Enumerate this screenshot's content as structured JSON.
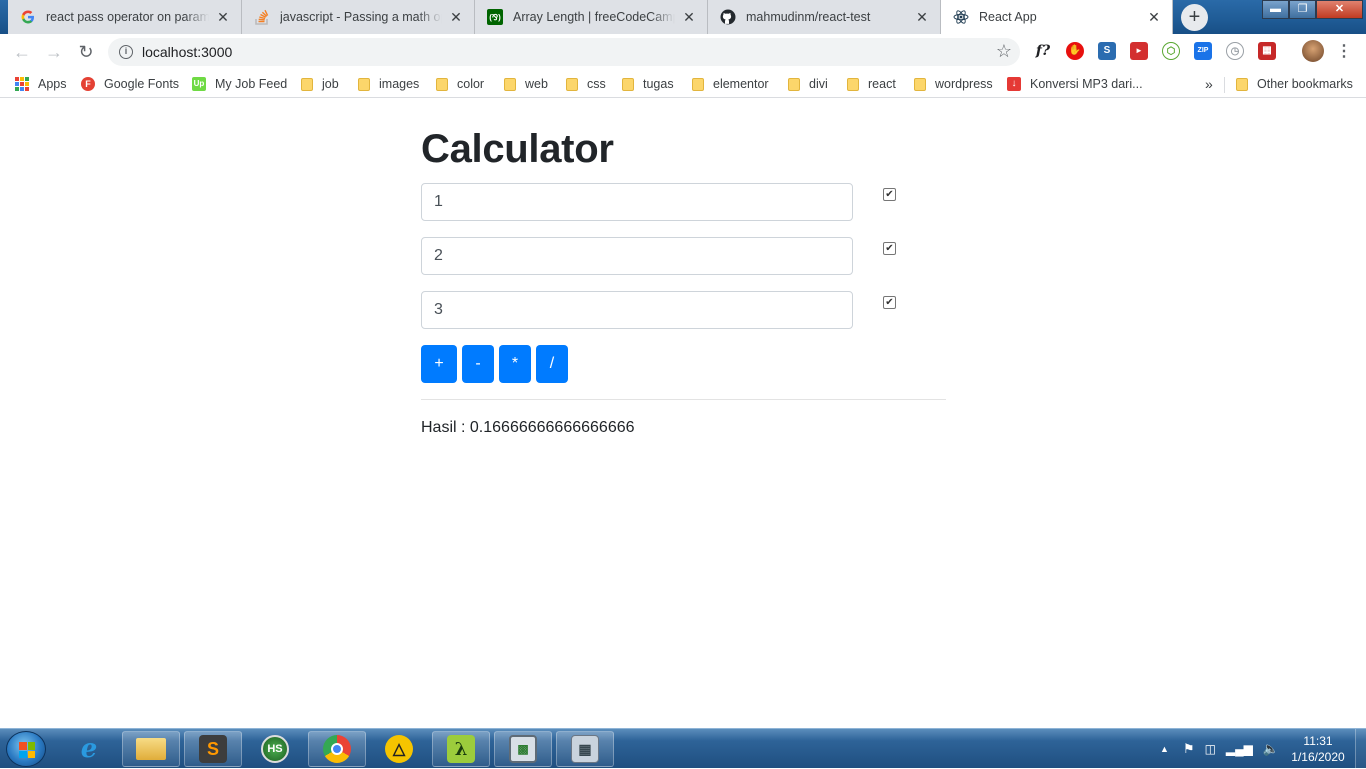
{
  "browser": {
    "tabs": [
      {
        "title": "react pass operator on parameter",
        "favicon": "google-icon"
      },
      {
        "title": "javascript - Passing a math operator",
        "favicon": "stackoverflow-icon"
      },
      {
        "title": "Array Length | freeCodeCamp Guide",
        "favicon": "freecodecamp-icon"
      },
      {
        "title": "mahmudinm/react-test",
        "favicon": "github-icon"
      },
      {
        "title": "React App",
        "favicon": "react-icon"
      }
    ],
    "url": "localhost:3000"
  },
  "bookmarks": [
    {
      "label": "Apps",
      "icon": "apps-grid-icon"
    },
    {
      "label": "Google Fonts",
      "icon": "google-fonts-icon"
    },
    {
      "label": "My Job Feed",
      "icon": "upwork-icon"
    },
    {
      "label": "job",
      "icon": "folder-icon"
    },
    {
      "label": "images",
      "icon": "folder-icon"
    },
    {
      "label": "color",
      "icon": "folder-icon"
    },
    {
      "label": "web",
      "icon": "folder-icon"
    },
    {
      "label": "css",
      "icon": "folder-icon"
    },
    {
      "label": "tugas",
      "icon": "folder-icon"
    },
    {
      "label": "elementor",
      "icon": "folder-icon"
    },
    {
      "label": "divi",
      "icon": "folder-icon"
    },
    {
      "label": "react",
      "icon": "folder-icon"
    },
    {
      "label": "wordpress",
      "icon": "folder-icon"
    },
    {
      "label": "Konversi MP3 dari...",
      "icon": "download-icon"
    }
  ],
  "bookmarks_overflow": "»",
  "other_bookmarks": "Other bookmarks",
  "app": {
    "title": "Calculator",
    "inputs": [
      {
        "value": "1",
        "checked": true
      },
      {
        "value": "2",
        "checked": true
      },
      {
        "value": "3",
        "checked": true
      }
    ],
    "operators": [
      "+",
      "-",
      "*",
      "/"
    ],
    "result_label": "Hasil : 0.16666666666666666"
  },
  "taskbar": {
    "time": "11:31",
    "date": "1/16/2020"
  },
  "colors": {
    "primary": "#007bff",
    "text": "#212529",
    "taskbar": "#1f4f80"
  }
}
